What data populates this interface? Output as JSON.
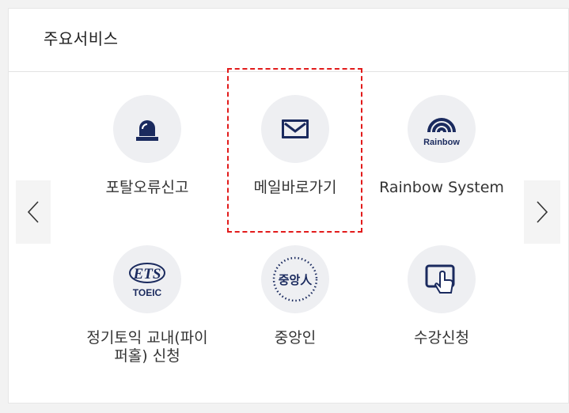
{
  "section": {
    "title": "주요서비스"
  },
  "nav": {
    "prev_icon": "chevron-left-icon",
    "next_icon": "chevron-right-icon"
  },
  "services": [
    {
      "label": "포탈오류신고",
      "icon": "siren-icon"
    },
    {
      "label": "메일바로가기",
      "icon": "mail-icon"
    },
    {
      "label": "Rainbow System",
      "icon": "rainbow-logo-icon",
      "icon_text": "Rainbow"
    },
    {
      "label": "정기토익 교내(파이퍼홀) 신청",
      "icon": "ets-toeic-logo-icon",
      "icon_text_top": "ETS",
      "icon_text_bottom": "TOEIC"
    },
    {
      "label": "중앙인",
      "icon": "jungangin-logo-icon",
      "icon_text": "중앙人"
    },
    {
      "label": "수강신청",
      "icon": "touch-screen-icon"
    }
  ],
  "colors": {
    "icon_navy": "#1a2a5e",
    "highlight": "#e21b1b",
    "circle_bg": "#eeeff2"
  }
}
